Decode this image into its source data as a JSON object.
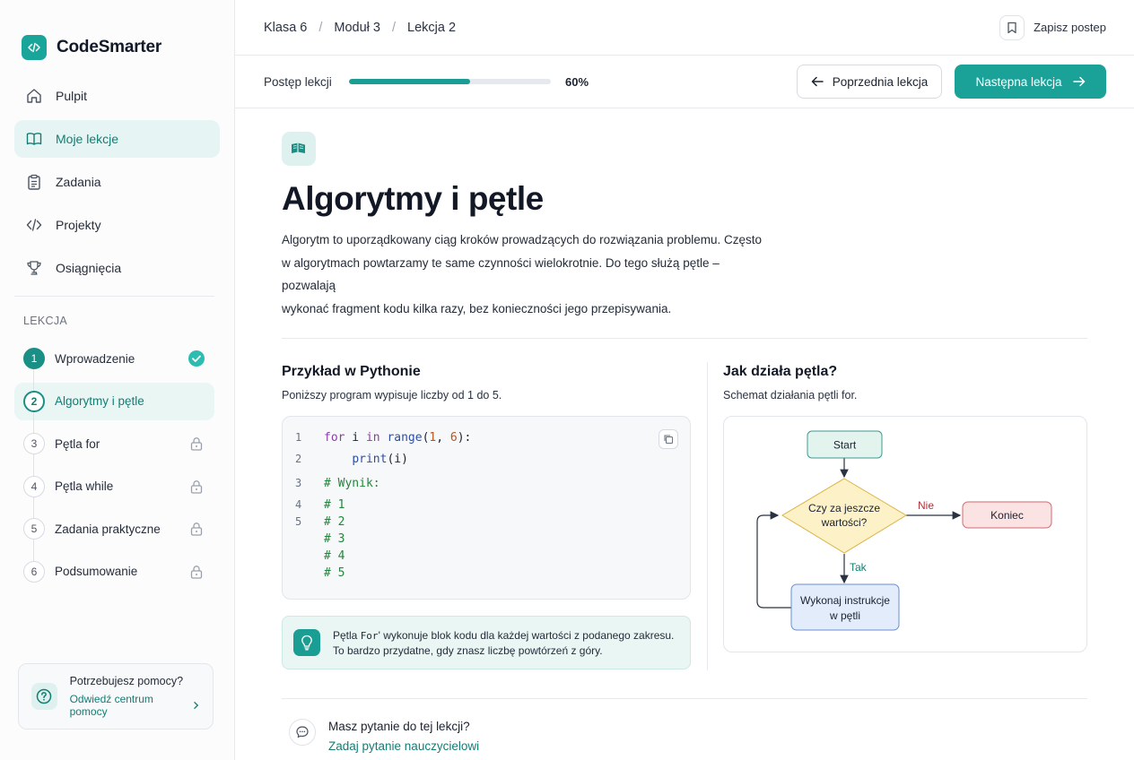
{
  "brand": {
    "name": "CodeSmarter"
  },
  "nav": [
    {
      "label": "Pulpit",
      "icon": "home-icon",
      "active": false
    },
    {
      "label": "Moje lekcje",
      "icon": "book-icon",
      "active": true
    },
    {
      "label": "Zadania",
      "icon": "clipboard-icon",
      "active": false
    },
    {
      "label": "Projekty",
      "icon": "code-icon",
      "active": false
    },
    {
      "label": "Osiągnięcia",
      "icon": "trophy-icon",
      "active": false
    }
  ],
  "lesson_section": {
    "label": "LEKCJA",
    "items": [
      {
        "num": "1",
        "title": "Wprowadzenie",
        "state": "done"
      },
      {
        "num": "2",
        "title": "Algorytmy i pętle",
        "state": "current"
      },
      {
        "num": "3",
        "title": "Pętla for",
        "state": "locked"
      },
      {
        "num": "4",
        "title": "Pętla while",
        "state": "locked"
      },
      {
        "num": "5",
        "title": "Zadania praktyczne",
        "state": "locked"
      },
      {
        "num": "6",
        "title": "Podsumowanie",
        "state": "locked"
      }
    ]
  },
  "help": {
    "title": "Potrzebujesz pomocy?",
    "link": "Odwiedź centrum pomocy"
  },
  "breadcrumb": [
    "Klasa 6",
    "Moduł 3",
    "Lekcja 2"
  ],
  "save_label": "Zapisz postep",
  "progress": {
    "label": "Postęp lekcji",
    "value": 60,
    "text": "60%"
  },
  "nav_buttons": {
    "prev": "Poprzednia lekcja",
    "next": "Następna lekcja"
  },
  "lesson": {
    "title": "Algorytmy i pętle",
    "intro_lines": [
      "Algorytm to uporządkowany ciąg kroków prowadzących do rozwiązania problemu. Często",
      "w algorytmach powtarzamy te same czynności wielokrotnie. Do tego służą pętle – pozwalają",
      "wykonać fragment kodu kilka razy, bez konieczności jego przepisywania."
    ]
  },
  "example": {
    "title": "Przykład w Pythonie",
    "subtitle": "Poniższy program wypisuje liczby od 1 do 5.",
    "code_lines": [
      {
        "num": "1",
        "text": "for i in range(1, 6):"
      },
      {
        "num": "2",
        "text": "    print(i)"
      },
      {
        "num": "3",
        "text": "# Wynik:"
      },
      {
        "num": "4",
        "text": "# 1"
      },
      {
        "num": "5",
        "text": "# 2"
      },
      {
        "num": "",
        "text": "# 3"
      },
      {
        "num": "",
        "text": "# 4"
      },
      {
        "num": "",
        "text": "# 5"
      }
    ]
  },
  "tip": {
    "line1_a": "Pętla ",
    "line1_code": "For",
    "line1_b": "' wykonuje blok kodu dla każdej wartości z podanego zakresu.",
    "line2": "To bardzo przydatne, gdy znasz liczbę powtórzeń z góry."
  },
  "flow": {
    "title": "Jak działa pętla?",
    "subtitle": "Schemat działania pętli for.",
    "start": "Start",
    "decision_1": "Czy za jeszcze",
    "decision_2": "wartości?",
    "no": "Nie",
    "yes": "Tak",
    "end": "Koniec",
    "body_1": "Wykonaj instrukcje",
    "body_2": "w pętli",
    "colors": {
      "start": "#e3f4ef",
      "decision": "#fdf1c7",
      "end": "#fbe3e3",
      "body": "#e3ecfb"
    }
  },
  "question": {
    "title": "Masz pytanie do tej lekcji?",
    "link": "Zadaj pytanie nauczycielowi"
  }
}
